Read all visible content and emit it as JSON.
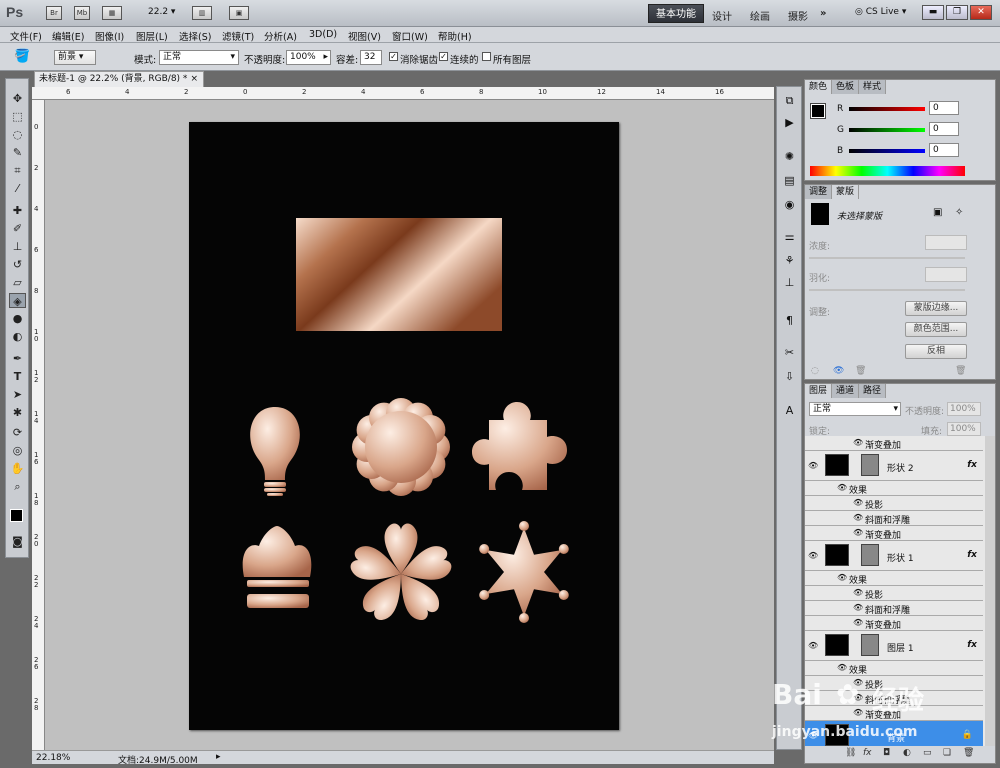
{
  "app": {
    "logo": "Ps",
    "bridge": "Br",
    "mini_bridge": "Mb",
    "zoom": "22.2",
    "workspace_active": "基本功能",
    "workspaces": [
      "设计",
      "绘画",
      "摄影"
    ],
    "more": "»",
    "cs_live": "CS Live"
  },
  "menu": [
    "文件(F)",
    "编辑(E)",
    "图像(I)",
    "图层(L)",
    "选择(S)",
    "滤镜(T)",
    "分析(A)",
    "3D(D)",
    "视图(V)",
    "窗口(W)",
    "帮助(H)"
  ],
  "options": {
    "fill_source": "前景",
    "mode_label": "模式:",
    "mode_value": "正常",
    "opacity_label": "不透明度:",
    "opacity_value": "100%",
    "tolerance_label": "容差:",
    "tolerance_value": "32",
    "antialias": "消除锯齿",
    "contiguous": "连续的",
    "all_layers": "所有图层"
  },
  "document": {
    "tab_title": "未标题-1 @ 22.2% (背景, RGB/8) *",
    "ruler_top": [
      "6",
      "4",
      "2",
      "0",
      "2",
      "4",
      "6",
      "8",
      "10",
      "12",
      "14",
      "16"
    ],
    "ruler_left": [
      "0",
      "2",
      "4",
      "6",
      "8",
      "1 0",
      "1 2",
      "1 4",
      "1 6",
      "1 8",
      "2 0",
      "2 2",
      "2 4",
      "2 6",
      "2 8"
    ],
    "status_zoom": "22.18%",
    "status_doc": "文档:24.9M/5.00M"
  },
  "panels": {
    "color": {
      "tabs": [
        "颜色",
        "色板",
        "样式"
      ],
      "r_label": "R",
      "g_label": "G",
      "b_label": "B",
      "r": "0",
      "g": "0",
      "b": "0"
    },
    "adjust": {
      "tabs": [
        "调整",
        "蒙版"
      ],
      "mask_title": "未选择蒙版",
      "density": "浓度:",
      "feather": "羽化:",
      "refine": "调整:",
      "btn_edge": "蒙版边缘...",
      "btn_color": "颜色范围...",
      "btn_invert": "反相"
    },
    "layers": {
      "tabs": [
        "图层",
        "通道",
        "路径"
      ],
      "blend": "正常",
      "opacity_label": "不透明度:",
      "opacity": "100%",
      "lock_label": "锁定:",
      "fill_label": "填充:",
      "fill": "100%",
      "rows": [
        {
          "type": "effect",
          "name": "渐变叠加"
        },
        {
          "type": "layer",
          "name": "形状 2",
          "fx": "fx"
        },
        {
          "type": "effects",
          "name": "效果"
        },
        {
          "type": "effect",
          "name": "投影"
        },
        {
          "type": "effect",
          "name": "斜面和浮雕"
        },
        {
          "type": "effect",
          "name": "渐变叠加"
        },
        {
          "type": "layer",
          "name": "形状 1",
          "fx": "fx"
        },
        {
          "type": "effects",
          "name": "效果"
        },
        {
          "type": "effect",
          "name": "投影"
        },
        {
          "type": "effect",
          "name": "斜面和浮雕"
        },
        {
          "type": "effect",
          "name": "渐变叠加"
        },
        {
          "type": "layer",
          "name": "图层 1",
          "fx": "fx"
        },
        {
          "type": "effects",
          "name": "效果"
        },
        {
          "type": "effect",
          "name": "投影"
        },
        {
          "type": "effect",
          "name": "斜面和浮雕"
        },
        {
          "type": "effect",
          "name": "渐变叠加"
        },
        {
          "type": "layer",
          "name": "背景",
          "selected": true
        }
      ]
    }
  },
  "watermark": {
    "brand": "Bai",
    "brand2": "经验",
    "url": "jingyan.baidu.com"
  },
  "colors": {
    "copper_light": "#f2d6c6",
    "copper_dark": "#8a4a2a",
    "selected_layer": "#3d8ee8"
  }
}
